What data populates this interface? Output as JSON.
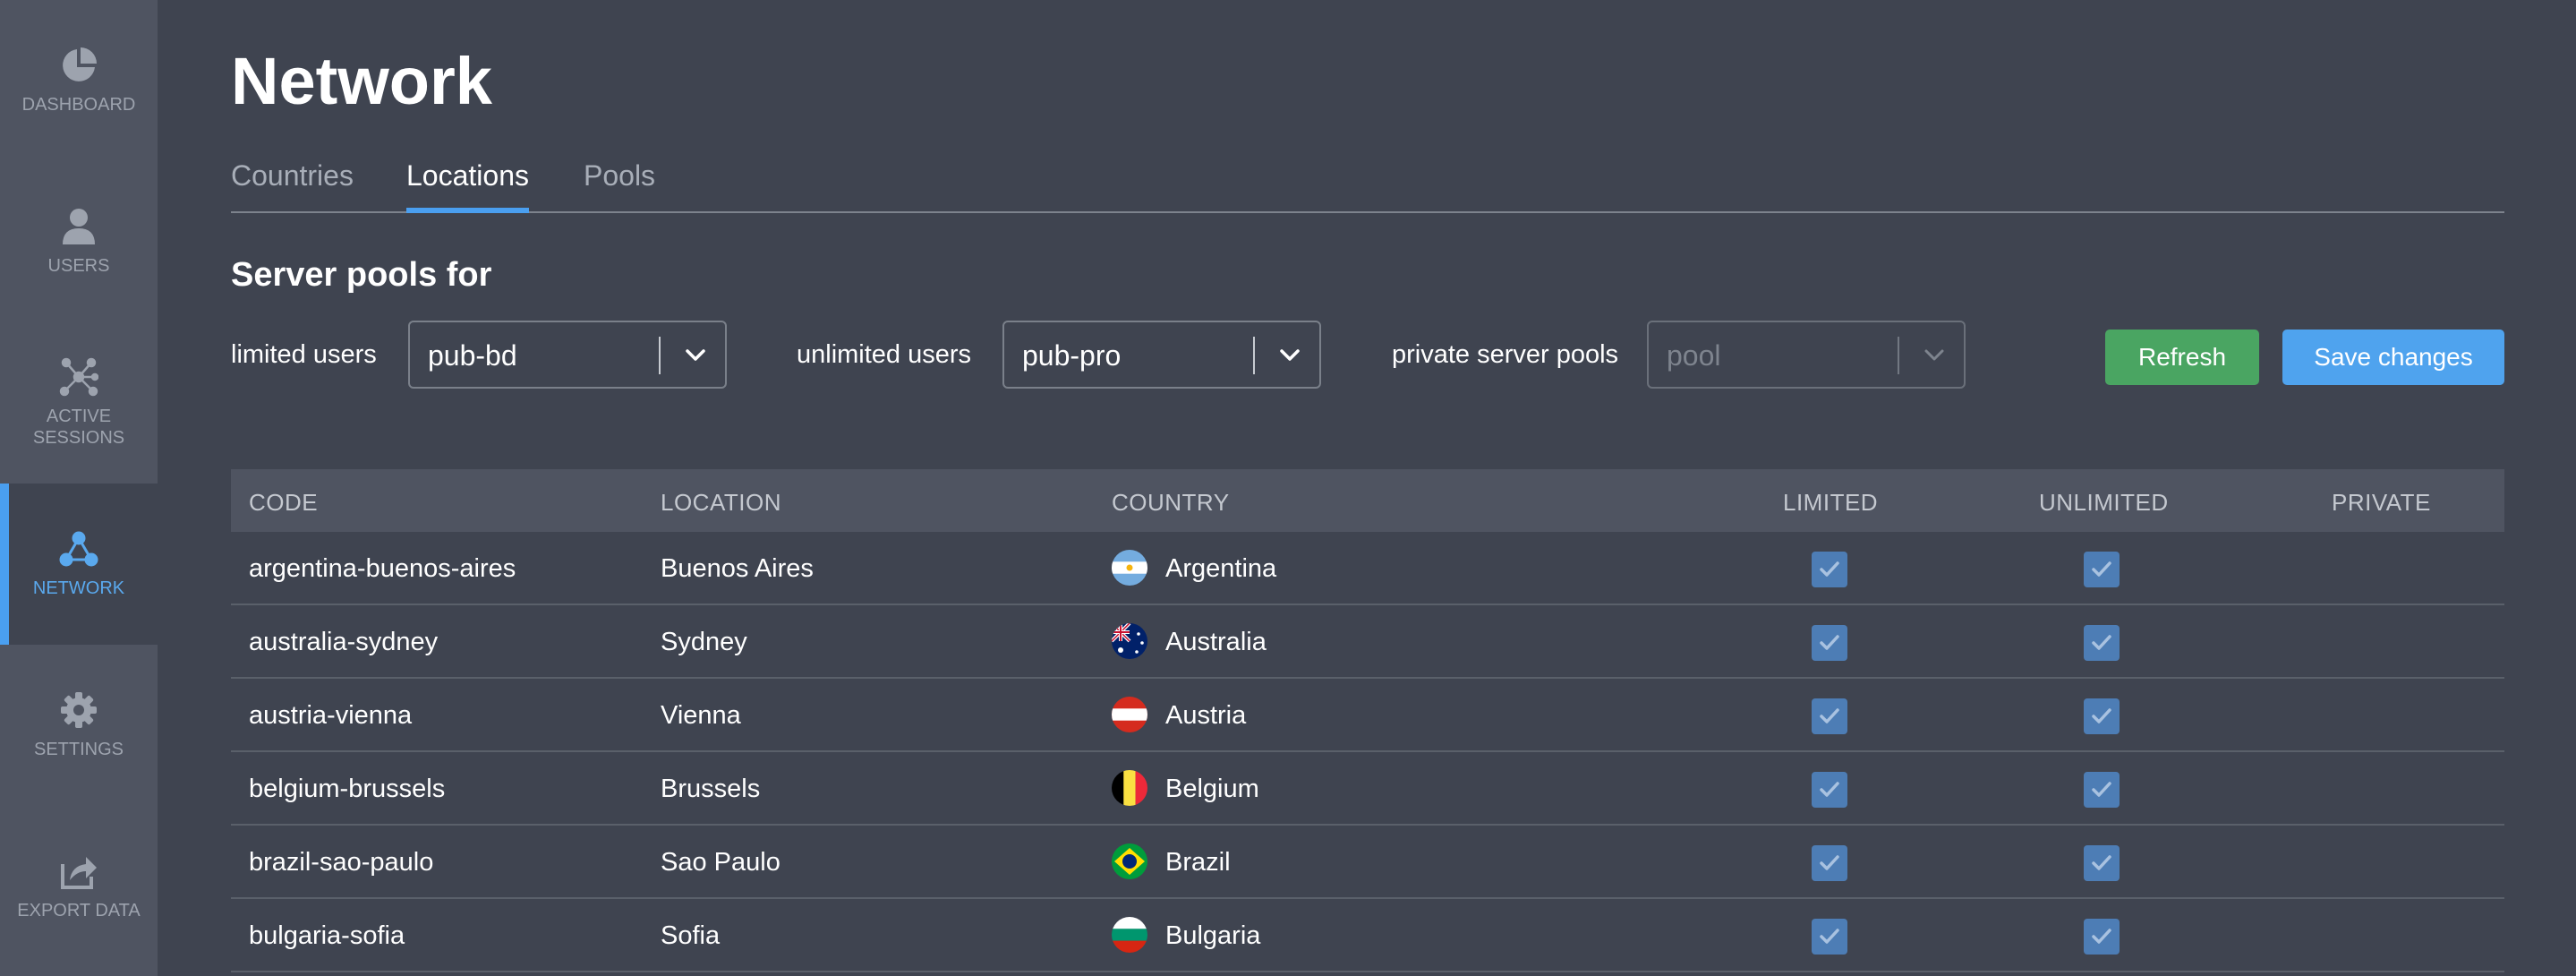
{
  "sidebar": {
    "items": [
      {
        "label": "DASHBOARD",
        "icon": "pie-chart-icon"
      },
      {
        "label": "USERS",
        "icon": "user-icon"
      },
      {
        "label": "ACTIVE\nSESSIONS",
        "icon": "sessions-network-icon"
      },
      {
        "label": "NETWORK",
        "icon": "network-icon",
        "active": true
      },
      {
        "label": "SETTINGS",
        "icon": "gear-icon"
      },
      {
        "label": "EXPORT DATA",
        "icon": "export-icon"
      }
    ]
  },
  "page": {
    "title": "Network",
    "tabs": [
      {
        "label": "Countries"
      },
      {
        "label": "Locations",
        "active": true
      },
      {
        "label": "Pools"
      }
    ],
    "section_title": "Server pools for"
  },
  "controls": {
    "limited": {
      "label": "limited users",
      "value": "pub-bd"
    },
    "unlimited": {
      "label": "unlimited users",
      "value": "pub-pro"
    },
    "private": {
      "label": "private server pools",
      "placeholder": "pool"
    },
    "refresh_label": "Refresh",
    "save_label": "Save changes"
  },
  "table": {
    "headers": {
      "code": "CODE",
      "location": "LOCATION",
      "country": "COUNTRY",
      "limited": "LIMITED",
      "unlimited": "UNLIMITED",
      "private": "PRIVATE"
    },
    "rows": [
      {
        "code": "argentina-buenos-aires",
        "location": "Buenos Aires",
        "country": "Argentina",
        "flag": "argentina-flag-icon",
        "limited": true,
        "unlimited": true
      },
      {
        "code": "australia-sydney",
        "location": "Sydney",
        "country": "Australia",
        "flag": "australia-flag-icon",
        "limited": true,
        "unlimited": true
      },
      {
        "code": "austria-vienna",
        "location": "Vienna",
        "country": "Austria",
        "flag": "austria-flag-icon",
        "limited": true,
        "unlimited": true
      },
      {
        "code": "belgium-brussels",
        "location": "Brussels",
        "country": "Belgium",
        "flag": "belgium-flag-icon",
        "limited": true,
        "unlimited": true
      },
      {
        "code": "brazil-sao-paulo",
        "location": "Sao Paulo",
        "country": "Brazil",
        "flag": "brazil-flag-icon",
        "limited": true,
        "unlimited": true
      },
      {
        "code": "bulgaria-sofia",
        "location": "Sofia",
        "country": "Bulgaria",
        "flag": "bulgaria-flag-icon",
        "limited": true,
        "unlimited": true
      }
    ]
  },
  "colors": {
    "background": "#3f4450",
    "sidebar": "#4f5461",
    "accent": "#4a9ff0",
    "refresh": "#4aa562",
    "checkbox": "#4d7db5"
  }
}
